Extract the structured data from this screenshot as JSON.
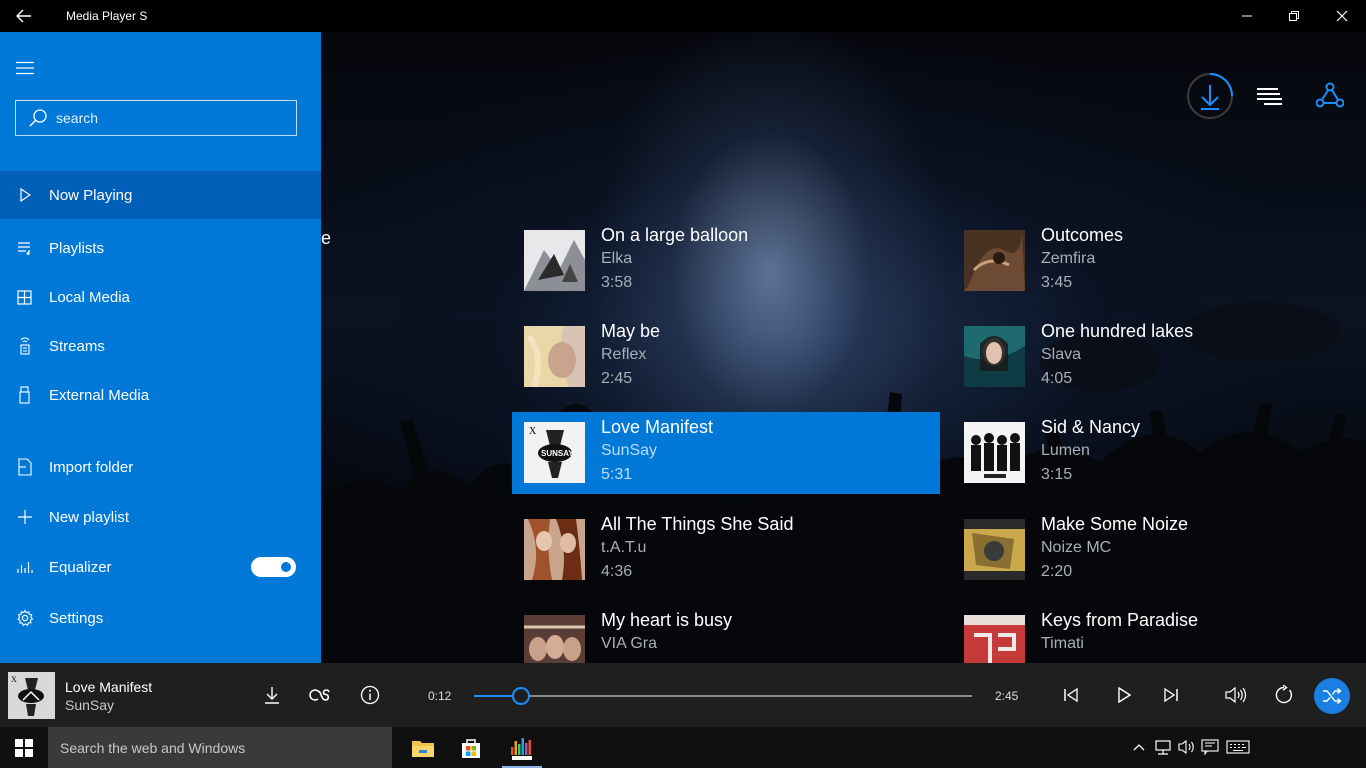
{
  "window": {
    "title": "Media Player S"
  },
  "sidebar": {
    "search_placeholder": "search",
    "nav": [
      {
        "label": "Now Playing",
        "icon": "play-icon",
        "active": true
      },
      {
        "label": "Playlists",
        "icon": "playlist-icon"
      },
      {
        "label": "Local Media",
        "icon": "grid-icon"
      },
      {
        "label": "Streams",
        "icon": "stream-icon"
      },
      {
        "label": "External Media",
        "icon": "usb-icon"
      }
    ],
    "actions": [
      {
        "label": "Import folder",
        "icon": "folder-icon"
      },
      {
        "label": "New playlist",
        "icon": "plus-icon"
      },
      {
        "label": "Equalizer",
        "icon": "equalizer-icon",
        "toggle_on": true
      },
      {
        "label": "Settings",
        "icon": "gear-icon"
      }
    ]
  },
  "main": {
    "cutoff_text": "e",
    "songs": [
      {
        "title": "On a large balloon",
        "artist": "Elka",
        "duration": "3:58"
      },
      {
        "title": "Outcomes",
        "artist": "Zemfira",
        "duration": "3:45"
      },
      {
        "title": "May be",
        "artist": "Reflex",
        "duration": "2:45"
      },
      {
        "title": "One hundred lakes",
        "artist": "Slava",
        "duration": "4:05"
      },
      {
        "title": "Love Manifest",
        "artist": "SunSay",
        "duration": "5:31",
        "selected": true
      },
      {
        "title": "Sid & Nancy",
        "artist": "Lumen",
        "duration": "3:15"
      },
      {
        "title": "All The Things She Said",
        "artist": "t.A.T.u",
        "duration": "4:36"
      },
      {
        "title": "Make Some Noize",
        "artist": "Noize MC",
        "duration": "2:20"
      },
      {
        "title": "My heart is busy",
        "artist": "VIA Gra",
        "duration": ""
      },
      {
        "title": "Keys from Paradise",
        "artist": "Timati",
        "duration": ""
      }
    ]
  },
  "player": {
    "title": "Love Manifest",
    "artist": "SunSay",
    "current_time": "0:12",
    "total_time": "2:45",
    "progress_fraction": 0.094
  },
  "taskbar": {
    "search_placeholder": "Search the web and Windows"
  },
  "colors": {
    "accent": "#0078d7",
    "accent_dark": "#005fb8",
    "player_bg": "#1f1f1f",
    "progress": "#1a8fff"
  }
}
